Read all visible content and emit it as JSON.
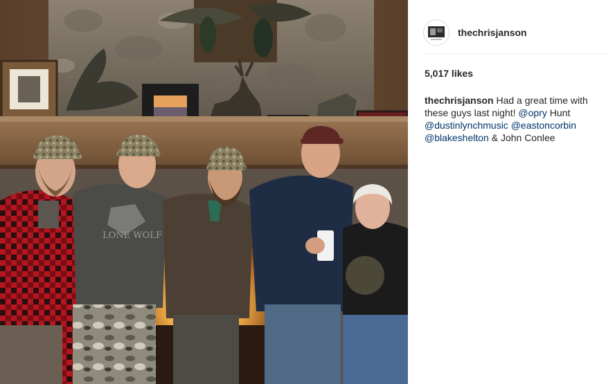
{
  "post": {
    "username": "thechrisjanson",
    "likes": "5,017 likes",
    "caption": {
      "author": "thechrisjanson",
      "text_1": " Had a great time with these guys last night! ",
      "mention_1": "@opry",
      "text_2": " Hunt ",
      "mention_2": "@dustinlynchmusic",
      "text_3": " ",
      "mention_3": "@eastoncorbin",
      "text_4": " ",
      "mention_4": "@blakeshelton",
      "text_5": " & John Conlee"
    }
  },
  "photo": {
    "subject": "five-men-group-photo",
    "shirt_label": "LONE WOLF"
  },
  "colors": {
    "text": "#262626",
    "mention": "#003569",
    "divider": "#efefef",
    "border": "#dbdbdb"
  }
}
